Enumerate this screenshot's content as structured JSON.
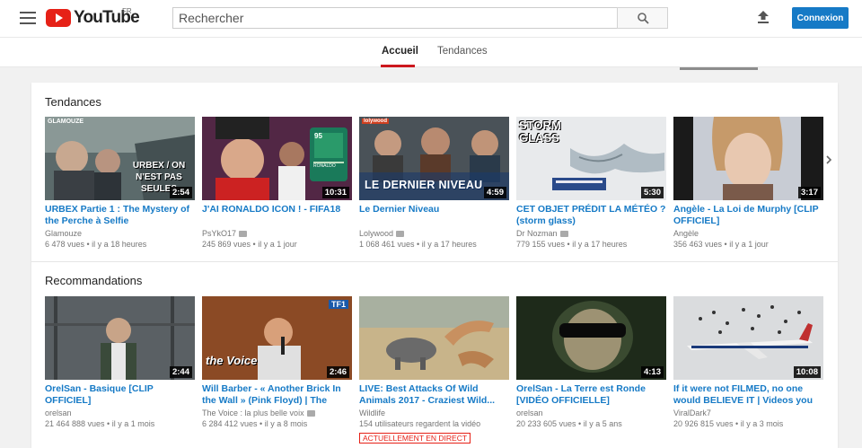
{
  "header": {
    "logo_text": "YouTube",
    "country": "FR",
    "search_placeholder": "Rechercher",
    "signin_label": "Connexion"
  },
  "tabs": [
    {
      "label": "Accueil",
      "active": true
    },
    {
      "label": "Tendances",
      "active": false
    }
  ],
  "sections": [
    {
      "title": "Tendances",
      "videos": [
        {
          "title": "URBEX Partie 1 : The Mystery of the Perche à Selfie",
          "channel": "Glamouze",
          "verified": false,
          "meta": "6 478 vues  •  il y a 18 heures",
          "duration": "2:54",
          "overlay": "URBEX / ON N'EST PAS SEULES",
          "brand": "GLAMOUZE"
        },
        {
          "title": "J'AI RONALDO ICON ! - FIFA18",
          "channel": "PsYkO17",
          "verified": true,
          "meta": "245 869 vues  •  il y a 1 jour",
          "duration": "10:31",
          "card_value": "95",
          "card_name": "RONALDO"
        },
        {
          "title": "Le Dernier Niveau",
          "channel": "Lolywood",
          "verified": true,
          "meta": "1 068 461 vues  •  il y a 17 heures",
          "duration": "4:59",
          "overlay": "LE DERNIER NIVEAU",
          "brand": "lolywood"
        },
        {
          "title": "CET OBJET PRÉDIT LA MÉTÉO ? (storm glass)",
          "channel": "Dr Nozman",
          "verified": true,
          "meta": "779 155 vues  •  il y a 17 heures",
          "duration": "5:30",
          "overlay": "STORM GLASS"
        },
        {
          "title": "Angèle - La Loi de Murphy [CLIP OFFICIEL]",
          "channel": "Angèle",
          "verified": false,
          "meta": "356 463 vues  •  il y a 1 jour",
          "duration": "3:17"
        }
      ]
    },
    {
      "title": "Recommandations",
      "videos": [
        {
          "title": "OrelSan - Basique [CLIP OFFICIEL]",
          "channel": "orelsan",
          "verified": false,
          "meta": "21 464 888 vues  •  il y a 1 mois",
          "duration": "2:44"
        },
        {
          "title": "Will Barber - « Another Brick In the Wall » (Pink Floyd) | The Voice...",
          "channel": "The Voice : la plus belle voix",
          "verified": true,
          "meta": "6 284 412 vues  •  il y a 8 mois",
          "duration": "2:46",
          "overlay": "the Voice",
          "brand": "TF1"
        },
        {
          "title": "LIVE: Best Attacks Of Wild Animals 2017 - Craziest Wild...",
          "channel": "Wildlife",
          "verified": false,
          "meta": "154 utilisateurs regardent la vidéo",
          "live_label": "ACTUELLEMENT EN DIRECT"
        },
        {
          "title": "OrelSan - La Terre est Ronde [VIDÉO OFFICIELLE]",
          "channel": "orelsan",
          "verified": false,
          "meta": "20 233 605 vues  •  il y a 5 ans",
          "duration": "4:13"
        },
        {
          "title": "If it were not FILMED, no one would BELIEVE IT | Videos you w...",
          "channel": "ViralDark7",
          "verified": false,
          "meta": "20 926 815 vues  •  il y a 3 mois",
          "duration": "10:08"
        }
      ]
    }
  ],
  "colors": {
    "brand_red": "#e62117",
    "link_blue": "#167ac6",
    "signin_blue": "#167ac6"
  }
}
